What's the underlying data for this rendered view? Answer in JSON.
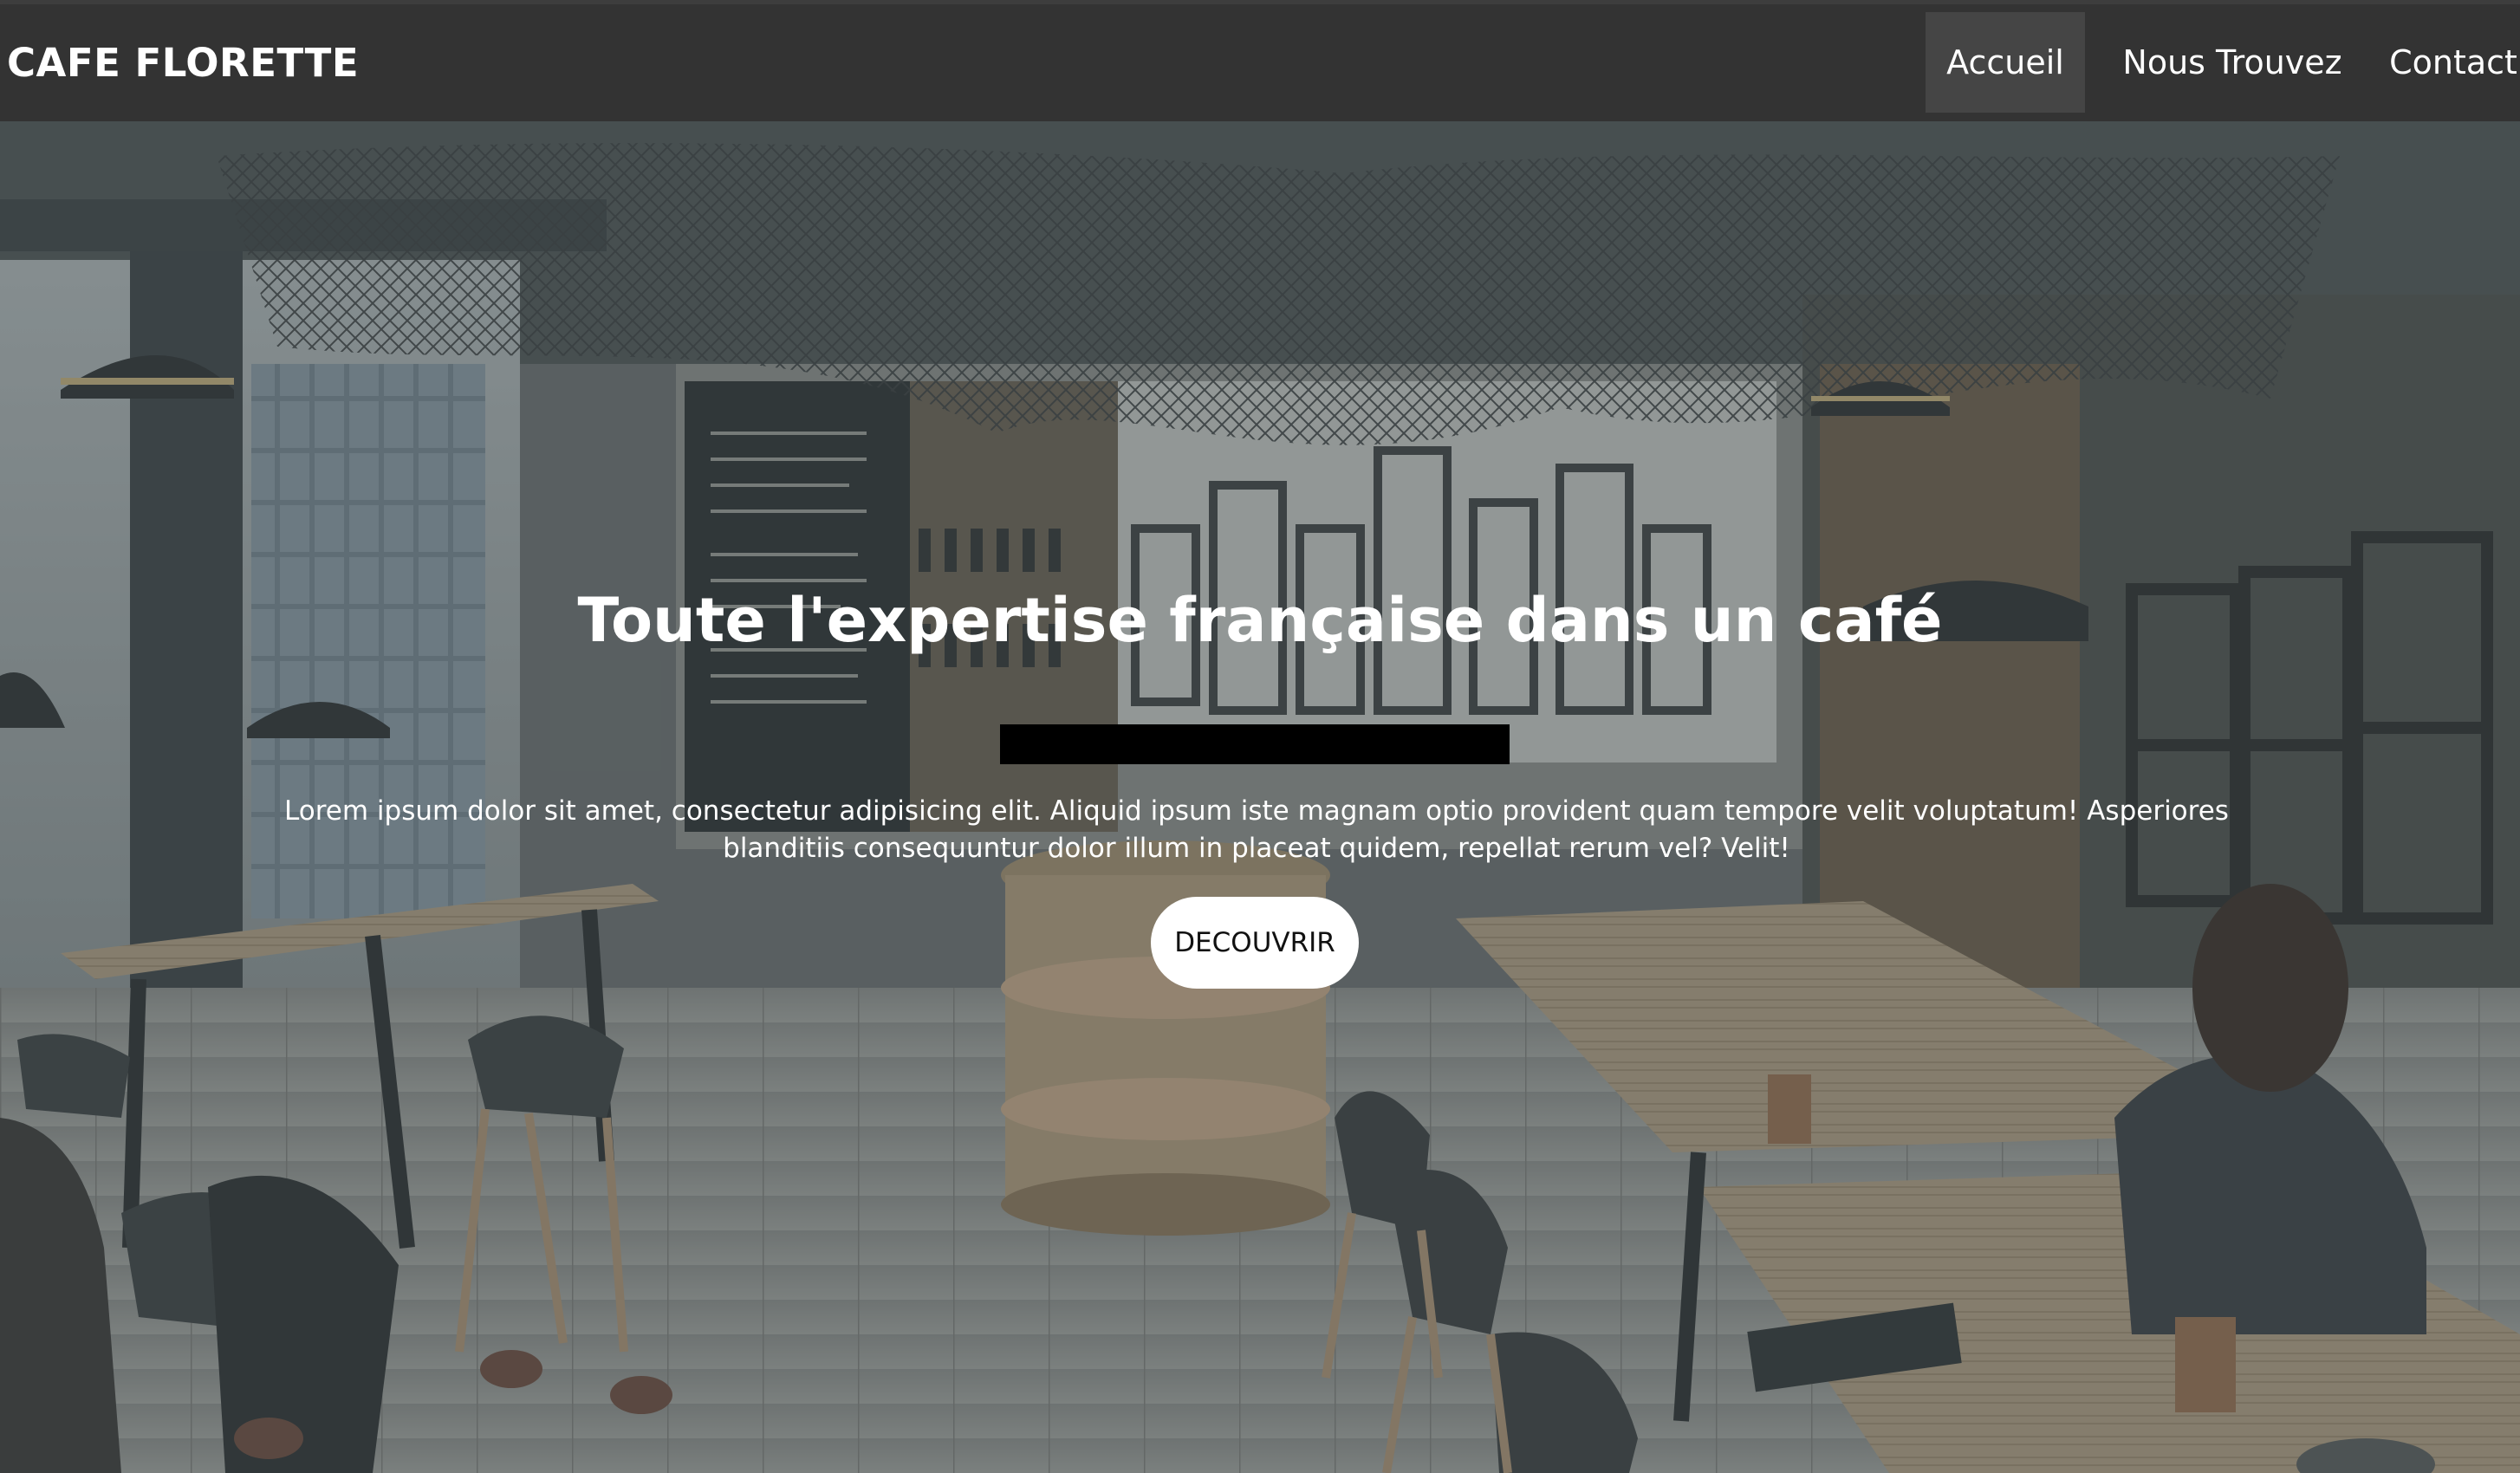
{
  "navbar": {
    "brand": "CAFE FLORETTE",
    "links": [
      {
        "label": "Accueil",
        "active": true
      },
      {
        "label": "Nous Trouvez",
        "active": false
      },
      {
        "label": "Contact",
        "active": false
      }
    ]
  },
  "hero": {
    "title": "Toute l'expertise française dans un café",
    "text": "Lorem ipsum dolor sit amet, consectetur adipisicing elit. Aliquid ipsum iste magnam optio provident quam tempore velit voluptatum! Asperiores blanditiis consequuntur dolor illum in placeat quidem, repellat rerum vel? Velit!",
    "button_label": "DECOUVRIR"
  },
  "colors": {
    "navbar_bg": "#333333",
    "active_link_bg": "#454545",
    "text": "#ffffff",
    "button_bg": "#ffffff",
    "button_text": "#111111"
  }
}
